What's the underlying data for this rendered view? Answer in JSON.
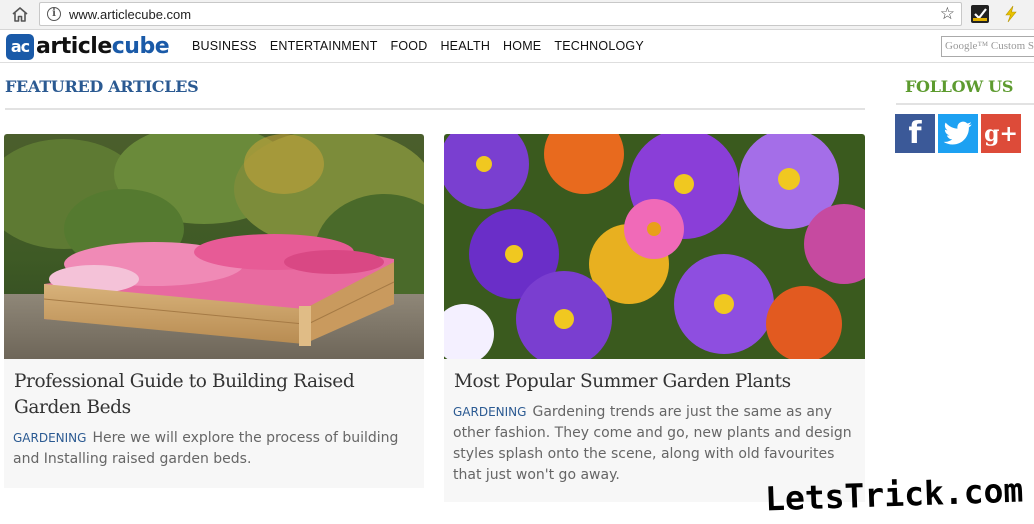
{
  "browser": {
    "url": "www.articlecube.com"
  },
  "site": {
    "logo_badge": "ac",
    "logo_word_1": "article",
    "logo_word_2": "cube",
    "nav": [
      "BUSINESS",
      "ENTERTAINMENT",
      "FOOD",
      "HEALTH",
      "HOME",
      "TECHNOLOGY"
    ],
    "search_placeholder": "Google™ Custom Search"
  },
  "featured": {
    "heading": "FEATURED ARTICLES",
    "articles": [
      {
        "title": "Professional Guide to Building Raised Garden Beds",
        "category": "GARDENING",
        "excerpt": "Here we will explore the process of building and Installing raised garden beds."
      },
      {
        "title": "Most Popular Summer Garden Plants",
        "category": "GARDENING",
        "excerpt": "Gardening trends are just the same as any other fashion. They come and go, new plants and design styles splash onto the scene, along with old favourites that just won't go away."
      }
    ]
  },
  "sidebar": {
    "heading": "FOLLOW US",
    "social": [
      {
        "icon": "facebook-icon",
        "color": "#3b5998",
        "glyph": "f"
      },
      {
        "icon": "twitter-icon",
        "color": "#1da1f2"
      },
      {
        "icon": "google-plus-icon",
        "color": "#dd4b39",
        "glyph": "g+"
      }
    ]
  },
  "watermark": "LetsTrick.com",
  "colors": {
    "brand_blue": "#1a5aa8",
    "heading_blue": "#2b5a92",
    "follow_green": "#5d9b2f"
  }
}
